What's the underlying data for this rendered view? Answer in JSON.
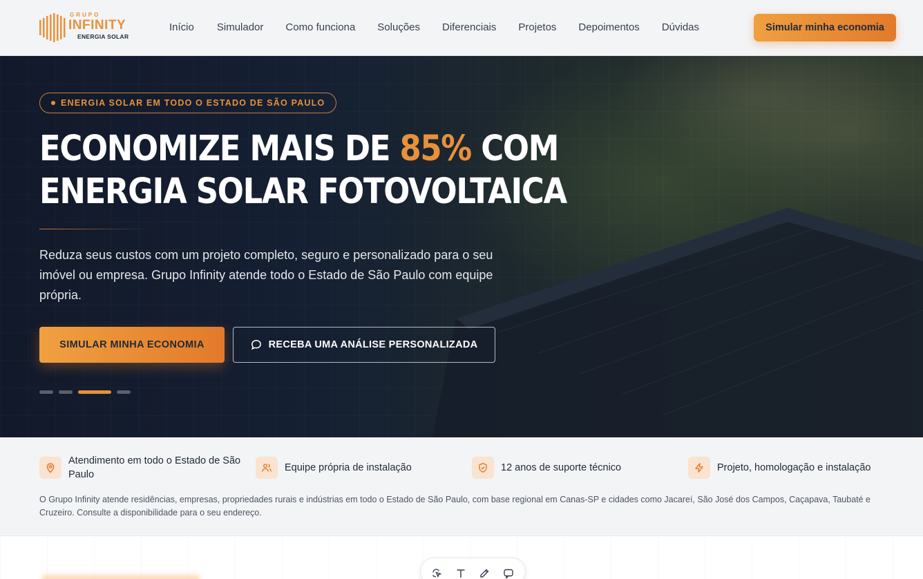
{
  "brand": {
    "grupo": "GRUPO",
    "name": "INFINITY",
    "tagline": "ENERGIA SOLAR",
    "accent_color": "#e8913a"
  },
  "nav": {
    "items": [
      {
        "label": "Início"
      },
      {
        "label": "Simulador"
      },
      {
        "label": "Como funciona"
      },
      {
        "label": "Soluções"
      },
      {
        "label": "Diferenciais"
      },
      {
        "label": "Projetos"
      },
      {
        "label": "Depoimentos"
      },
      {
        "label": "Dúvidas"
      }
    ],
    "cta_label": "Simular minha economia"
  },
  "hero": {
    "badge": "ENERGIA SOLAR EM TODO O ESTADO DE SÃO PAULO",
    "title_part1": "ECONOMIZE MAIS DE ",
    "title_accent": "85%",
    "title_part2": " COM",
    "title_line2": "ENERGIA SOLAR FOTOVOLTAICA",
    "description": "Reduza seus custos com um projeto completo, seguro e personalizado para o seu imóvel ou empresa. Grupo Infinity atende todo o Estado de São Paulo com equipe própria.",
    "primary_button": "SIMULAR MINHA ECONOMIA",
    "secondary_button": "RECEBA UMA ANÁLISE PERSONALIZADA",
    "slides_total": 4,
    "active_slide": 3
  },
  "features": {
    "items": [
      {
        "icon": "map-pin-icon",
        "text": "Atendimento em todo o Estado de São Paulo"
      },
      {
        "icon": "team-icon",
        "text": "Equipe própria de instalação"
      },
      {
        "icon": "shield-check-icon",
        "text": "12 anos de suporte técnico"
      },
      {
        "icon": "lightning-icon",
        "text": "Projeto, homologação e instalação"
      }
    ],
    "note": "O Grupo Infinity atende residências, empresas, propriedades rurais e indústrias em todo o Estado de São Paulo, com base regional em Canas-SP e cidades como Jacareí, São José dos Campos, Caçapava, Taubaté e Cruzeiro. Consulte a disponibilidade para o seu endereço."
  },
  "toolbar": {
    "tools": [
      "select-tool-icon",
      "text-tool-icon",
      "pen-tool-icon",
      "comment-tool-icon"
    ]
  }
}
